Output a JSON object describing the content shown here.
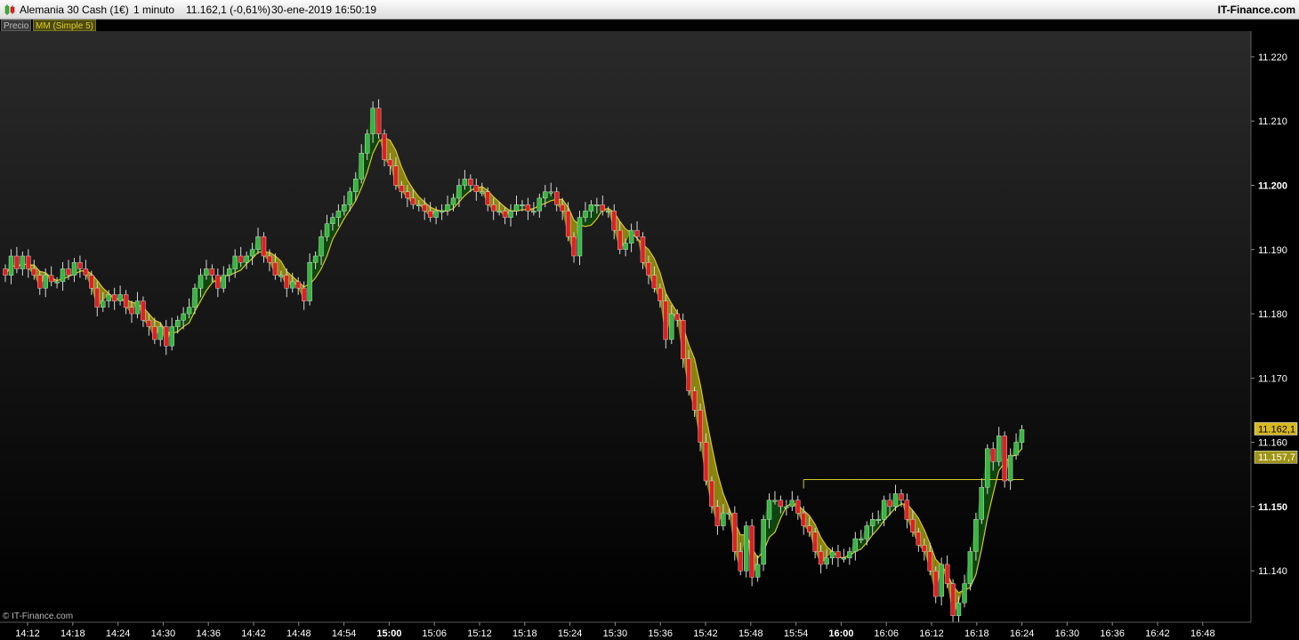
{
  "header": {
    "instrument": "Alemania 30 Cash (1€)",
    "timeframe": "1 minuto",
    "quote": "11.162,1 (-0,61%)",
    "datetime": "30-ene-2019 16:50:19",
    "brand": "IT-Finance.com"
  },
  "legend": {
    "price": "Precio",
    "indicator": "MM (Simple 5)"
  },
  "watermark": "© IT-Finance.com",
  "colors": {
    "up": "#37b63f",
    "down": "#e02020",
    "ma_line": "#d6c626",
    "fill_above": "#928a11",
    "fill_below": "#0f4a10",
    "last_price_bg": "#d8b821",
    "ma_label_bg": "#9f9414"
  },
  "chart_data": {
    "type": "candlestick",
    "title": "Alemania 30 Cash (1€)",
    "timeframe_minutes": 1,
    "ylim": [
      11132,
      11224
    ],
    "y_ticks": [
      {
        "value": 11220,
        "label": "11.220",
        "bold": false
      },
      {
        "value": 11210,
        "label": "11.210",
        "bold": false
      },
      {
        "value": 11200,
        "label": "11.200",
        "bold": true
      },
      {
        "value": 11190,
        "label": "11.190",
        "bold": false
      },
      {
        "value": 11180,
        "label": "11.180",
        "bold": false
      },
      {
        "value": 11170,
        "label": "11.170",
        "bold": false
      },
      {
        "value": 11160,
        "label": "11.160",
        "bold": false
      },
      {
        "value": 11150,
        "label": "11.150",
        "bold": true
      },
      {
        "value": 11140,
        "label": "11.140",
        "bold": false
      }
    ],
    "x_ticks": [
      {
        "label": "14:12",
        "bold": false
      },
      {
        "label": "14:18",
        "bold": false
      },
      {
        "label": "14:24",
        "bold": false
      },
      {
        "label": "14:30",
        "bold": false
      },
      {
        "label": "14:36",
        "bold": false
      },
      {
        "label": "14:42",
        "bold": false
      },
      {
        "label": "14:48",
        "bold": false
      },
      {
        "label": "14:54",
        "bold": false
      },
      {
        "label": "15:00",
        "bold": true
      },
      {
        "label": "15:06",
        "bold": false
      },
      {
        "label": "15:12",
        "bold": false
      },
      {
        "label": "15:18",
        "bold": false
      },
      {
        "label": "15:24",
        "bold": false
      },
      {
        "label": "15:30",
        "bold": false
      },
      {
        "label": "15:36",
        "bold": false
      },
      {
        "label": "15:42",
        "bold": false
      },
      {
        "label": "15:48",
        "bold": false
      },
      {
        "label": "15:54",
        "bold": false
      },
      {
        "label": "16:00",
        "bold": true
      },
      {
        "label": "16:06",
        "bold": false
      },
      {
        "label": "16:12",
        "bold": false
      },
      {
        "label": "16:18",
        "bold": false
      },
      {
        "label": "16:24",
        "bold": false
      },
      {
        "label": "16:30",
        "bold": false
      },
      {
        "label": "16:36",
        "bold": false
      },
      {
        "label": "16:42",
        "bold": false
      },
      {
        "label": "16:48",
        "bold": false
      }
    ],
    "closes": [
      11186,
      11189,
      11187,
      11189,
      11187,
      11186,
      11184,
      11186,
      11185,
      11185,
      11187,
      11186,
      11188,
      11187,
      11186,
      11184,
      11181,
      11182,
      11183,
      11182,
      11183,
      11181,
      11180,
      11182,
      11179,
      11178,
      11176,
      11178,
      11175,
      11178,
      11179,
      11180,
      11181,
      11184,
      11186,
      11187,
      11186,
      11184,
      11186,
      11187,
      11189,
      11188,
      11189,
      11190,
      11192,
      11189,
      11188,
      11186,
      11186,
      11184,
      11185,
      11184,
      11182,
      11188,
      11189,
      11192,
      11194,
      11195,
      11196,
      11197,
      11199,
      11201,
      11205,
      11208,
      11212,
      11208,
      11204,
      11203,
      11200,
      11199,
      11198,
      11197,
      11197,
      11196,
      11195,
      11196,
      11196,
      11197,
      11198,
      11200,
      11201,
      11200,
      11199,
      11199,
      11197,
      11196,
      11196,
      11195,
      11196,
      11197,
      11197,
      11196,
      11196,
      11198,
      11199,
      11199,
      11197,
      11196,
      11192,
      11189,
      11195,
      11196,
      11197,
      11197,
      11196,
      11196,
      11193,
      11190,
      11191,
      11193,
      11192,
      11188,
      11186,
      11184,
      11182,
      11176,
      11180,
      11179,
      11173,
      11168,
      11165,
      11160,
      11154,
      11150,
      11147,
      11149,
      11149,
      11143,
      11140,
      11147,
      11139,
      11141,
      11148,
      11151,
      11151,
      11150,
      11150,
      11151,
      11149,
      11147,
      11146,
      11143,
      11141,
      11142,
      11143,
      11142,
      11142,
      11143,
      11145,
      11145,
      11147,
      11148,
      11148,
      11151,
      11150,
      11152,
      11151,
      11148,
      11146,
      11144,
      11143,
      11140,
      11136,
      11141,
      11138,
      11133,
      11135,
      11138,
      11143,
      11148,
      11153,
      11159,
      11157,
      11161,
      11154,
      11158,
      11160,
      11162
    ],
    "ma": {
      "name": "MM (Simple 5)",
      "last_value": 11157.7,
      "last_label": "11.157,7"
    },
    "last_price": {
      "value": 11162.1,
      "label": "11.162,1"
    },
    "horizontal_line": {
      "value": 11154.2
    }
  }
}
